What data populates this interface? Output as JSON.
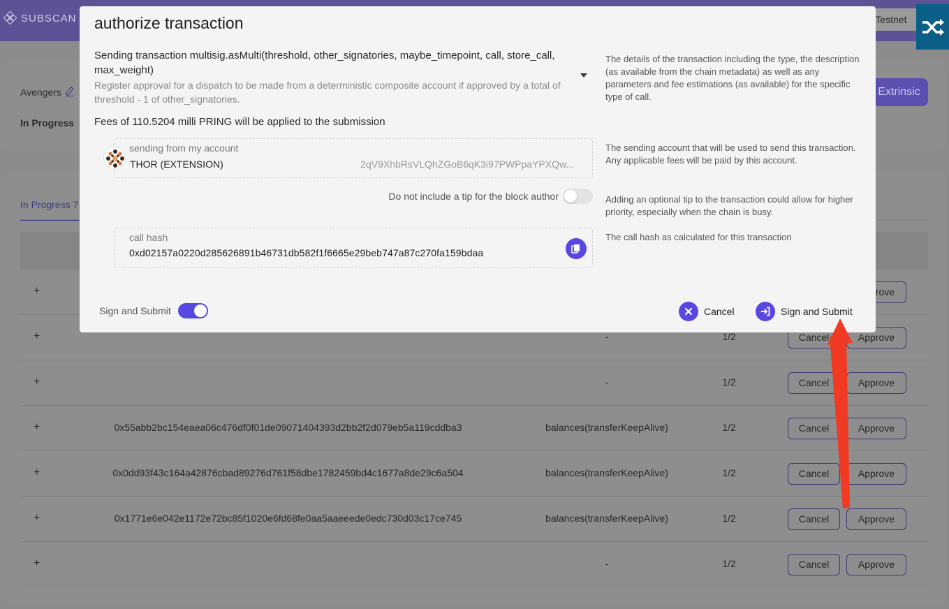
{
  "app": {
    "logo_text": "SUBSCAN",
    "network_chip": "n Testnet",
    "shuffle_icon": "shuffle-icon"
  },
  "multisig": {
    "name": "Avengers",
    "status": "In Progress",
    "extrinsic_button": "Extrinsic"
  },
  "tabs": {
    "in_progress": "In Progress  7"
  },
  "table": {
    "rows": [
      {
        "hash": "",
        "call": "",
        "ratio": "",
        "cancel": "",
        "approve": "Approve"
      },
      {
        "hash": "",
        "call": "-",
        "ratio": "1/2",
        "cancel": "Cancel",
        "approve": "Approve"
      },
      {
        "hash": "",
        "call": "-",
        "ratio": "1/2",
        "cancel": "Cancel",
        "approve": "Approve"
      },
      {
        "hash": "0x55abb2bc154eaea06c476df0f01de09071404393d2bb2f2d079eb5a119cddba3",
        "call": "balances(transferKeepAlive)",
        "ratio": "1/2",
        "cancel": "Cancel",
        "approve": "Approve"
      },
      {
        "hash": "0x0dd93f43c164a42876cbad89276d761f58dbe1782459bd4c1677a8de29c6a504",
        "call": "balances(transferKeepAlive)",
        "ratio": "1/2",
        "cancel": "Cancel",
        "approve": "Approve"
      },
      {
        "hash": "0x1771e6e042e1172e72bc85f1020e6fd68fe0aa5aaeeede0edc730d03c17ce745",
        "call": "balances(transferKeepAlive)",
        "ratio": "1/2",
        "cancel": "Cancel",
        "approve": "Approve"
      },
      {
        "hash": "",
        "call": "-",
        "ratio": "1/2",
        "cancel": "Cancel",
        "approve": "Approve"
      }
    ]
  },
  "modal": {
    "title": "authorize transaction",
    "tx_call": "Sending transaction multisig.asMulti(threshold, other_signatories, maybe_timepoint, call, store_call, max_weight)",
    "tx_description": "Register approval for a dispatch to be made from a deterministic composite account if approved by a total of threshold - 1 of other_signatories.",
    "fees": "Fees of 110.5204 milli PRING will be applied to the submission",
    "help_tx": "The details of the transaction including the type, the description (as available from the chain metadata) as well as any parameters and fee estimations (as available) for the specific type of call.",
    "help_account": "The sending account that will be used to send this transaction. Any applicable fees will be paid by this account.",
    "help_tip": "Adding an optional tip to the transaction could allow for higher priority, especially when the chain is busy.",
    "help_hash": "The call hash as calculated for this transaction",
    "account_label": "sending from my account",
    "account_name": "THOR (EXTENSION)",
    "account_address": "2qV9XhbRsVLQhZGoB6qK3i97PWPpaYPXQw...",
    "tip_label": "Do not include a tip for the block author",
    "tip_enabled": false,
    "hash_label": "call hash",
    "hash_value": "0xd02157a0220d285626891b46731db582f1f6665e29beb747a87c270fa159bdaa",
    "sign_submit_toggle_label": "Sign and Submit",
    "sign_submit_toggle_on": true,
    "cancel_label": "Cancel",
    "submit_label": "Sign and Submit"
  },
  "colors": {
    "accent": "#5847e0",
    "annotation_arrow": "#f03a24"
  }
}
